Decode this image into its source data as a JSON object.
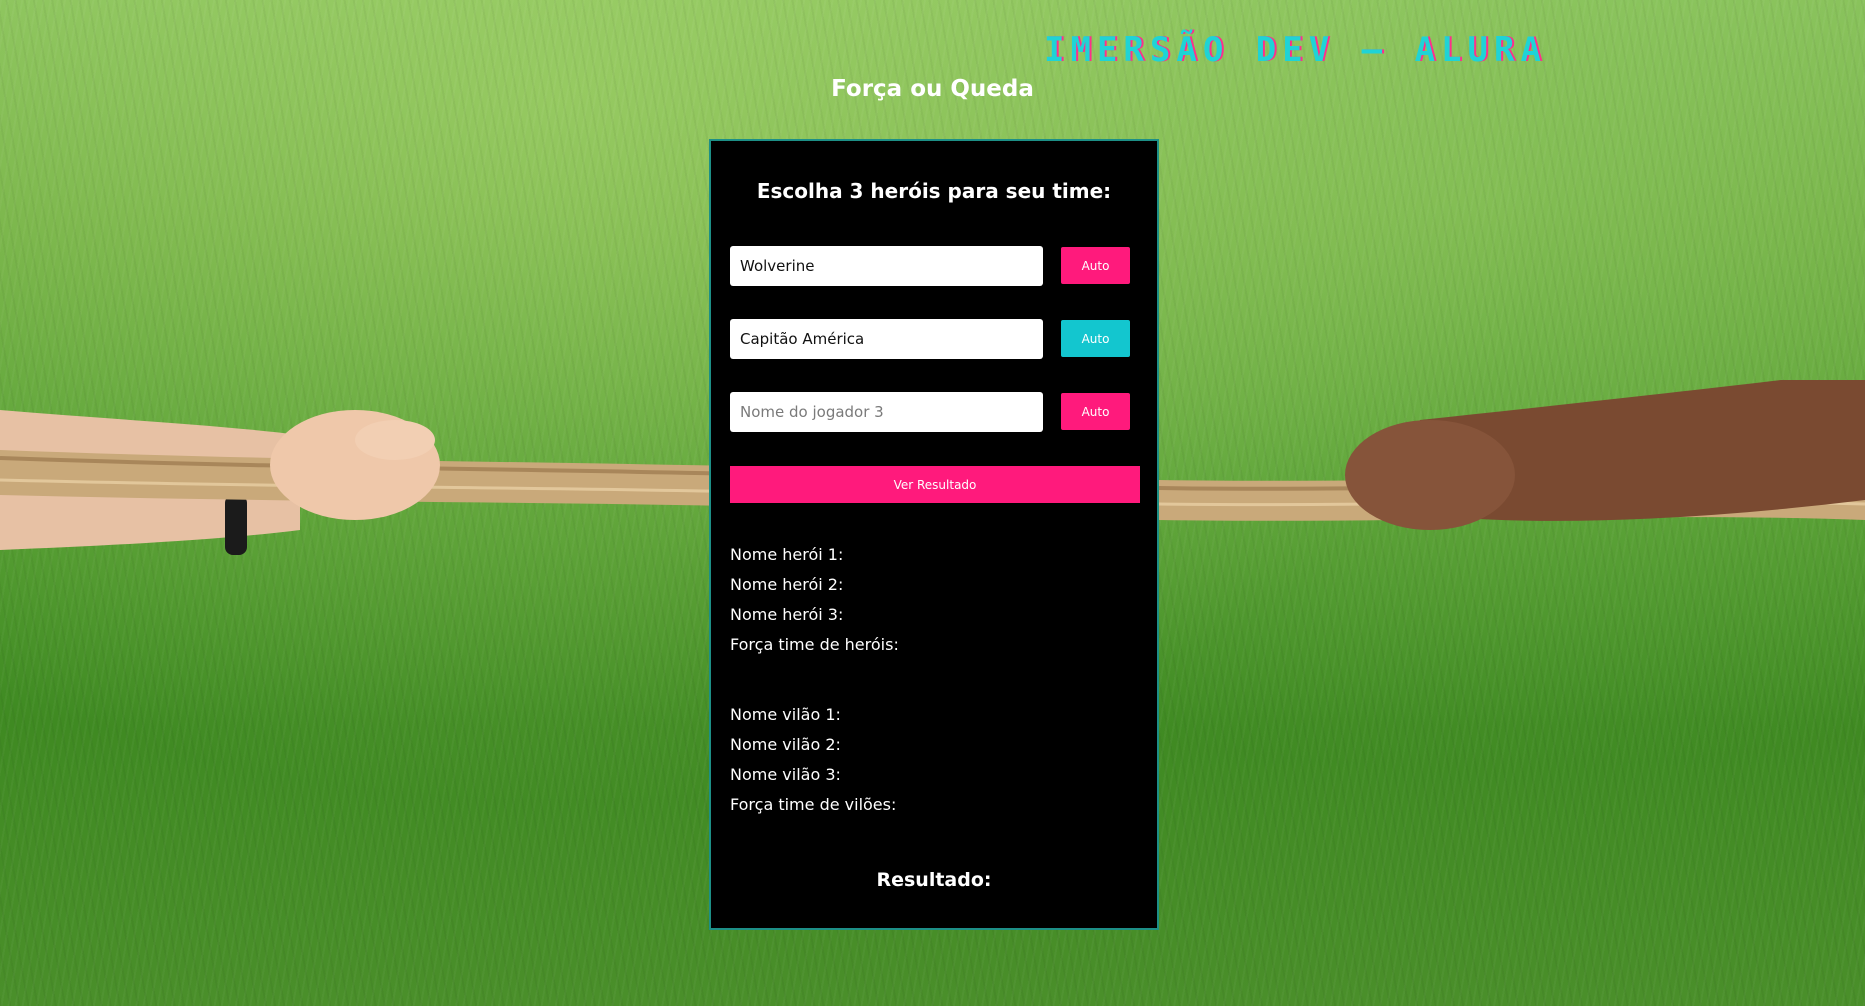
{
  "header": {
    "logo_text": "IMERSÃO DEV — ALURA",
    "title": "Força ou Queda"
  },
  "panel": {
    "heading": "Escolha 3 heróis para seu time:",
    "players": [
      {
        "value": "Wolverine",
        "placeholder": "",
        "auto_label": "Auto"
      },
      {
        "value": "Capitão América",
        "placeholder": "",
        "auto_label": "Auto"
      },
      {
        "value": "",
        "placeholder": "Nome do jogador 3",
        "auto_label": "Auto"
      }
    ],
    "result_button": "Ver Resultado",
    "heroes": {
      "hero1": "Nome herói 1:",
      "hero2": "Nome herói 2:",
      "hero3": "Nome herói 3:",
      "strength": "Força time de heróis:"
    },
    "villains": {
      "villain1": "Nome vilão 1:",
      "villain2": "Nome vilão 2:",
      "villain3": "Nome vilão 3:",
      "strength": "Força time de vilões:"
    },
    "result_label": "Resultado:"
  },
  "colors": {
    "accent_pink": "#ff1a7c",
    "accent_cyan": "#13c6cf",
    "panel_bg": "#000000"
  }
}
